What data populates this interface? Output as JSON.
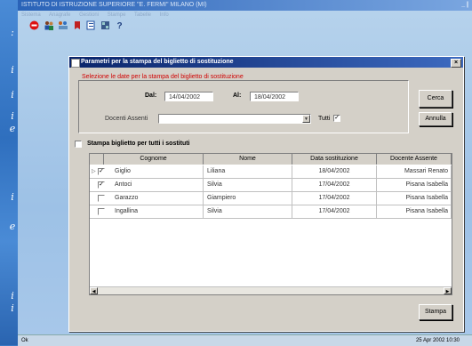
{
  "app": {
    "title": "ISTITUTO DI ISTRUZIONE SUPERIORE \"E. FERMI\" MILANO (MI)",
    "title_right": "_ |",
    "menu": [
      "Sistema",
      "Anagrafe",
      "Gestioni",
      "Stampe",
      "Tabelle",
      "Info"
    ]
  },
  "toolbar": {
    "icons": [
      "stop-icon",
      "users-icon",
      "group-icon",
      "bookmark-icon",
      "document-icon",
      "grid-icon",
      "help-icon"
    ]
  },
  "dialog": {
    "title": "Parametri per la stampa del biglietto di sostituzione",
    "close": "×",
    "group_caption": "Selezione le date per la stampa del biglietto di sostituzione",
    "dal_label": "Dal:",
    "dal_value": "14/04/2002",
    "al_label": "Al:",
    "al_value": "18/04/2002",
    "docenti_label": "Docenti Assenti",
    "docenti_value": "",
    "tutti_label": "Tutti",
    "tutti_checked": "✓",
    "cerca_label": "Cerca",
    "annulla_label": "Annulla",
    "stampa_all_label": "Stampa biglietto per tutti i sostituti",
    "stampa_label": "Stampa"
  },
  "table": {
    "columns": [
      "Cognome",
      "Nome",
      "Data sostituzione",
      "Docente Assente"
    ],
    "rows": [
      {
        "checked": "✓",
        "cognome": "Giglio",
        "nome": "Liliana",
        "data": "18/04/2002",
        "docente": "Massari Renato"
      },
      {
        "checked": "✓",
        "cognome": "Antoci",
        "nome": "Silvia",
        "data": "17/04/2002",
        "docente": "Pisana  Isabella"
      },
      {
        "checked": "",
        "cognome": "Garazzo",
        "nome": "Giampiero",
        "data": "17/04/2002",
        "docente": "Pisana  Isabella"
      },
      {
        "checked": "",
        "cognome": "Ingallina",
        "nome": "Silvia",
        "data": "17/04/2002",
        "docente": "Pisana  Isabella"
      }
    ]
  },
  "status": {
    "left": "Ok",
    "right": "25 Apr 2002 10:30"
  },
  "side": {
    "glyphs": [
      ":",
      "i",
      "i",
      "i",
      "e",
      "i",
      "e",
      "i",
      "i"
    ]
  }
}
